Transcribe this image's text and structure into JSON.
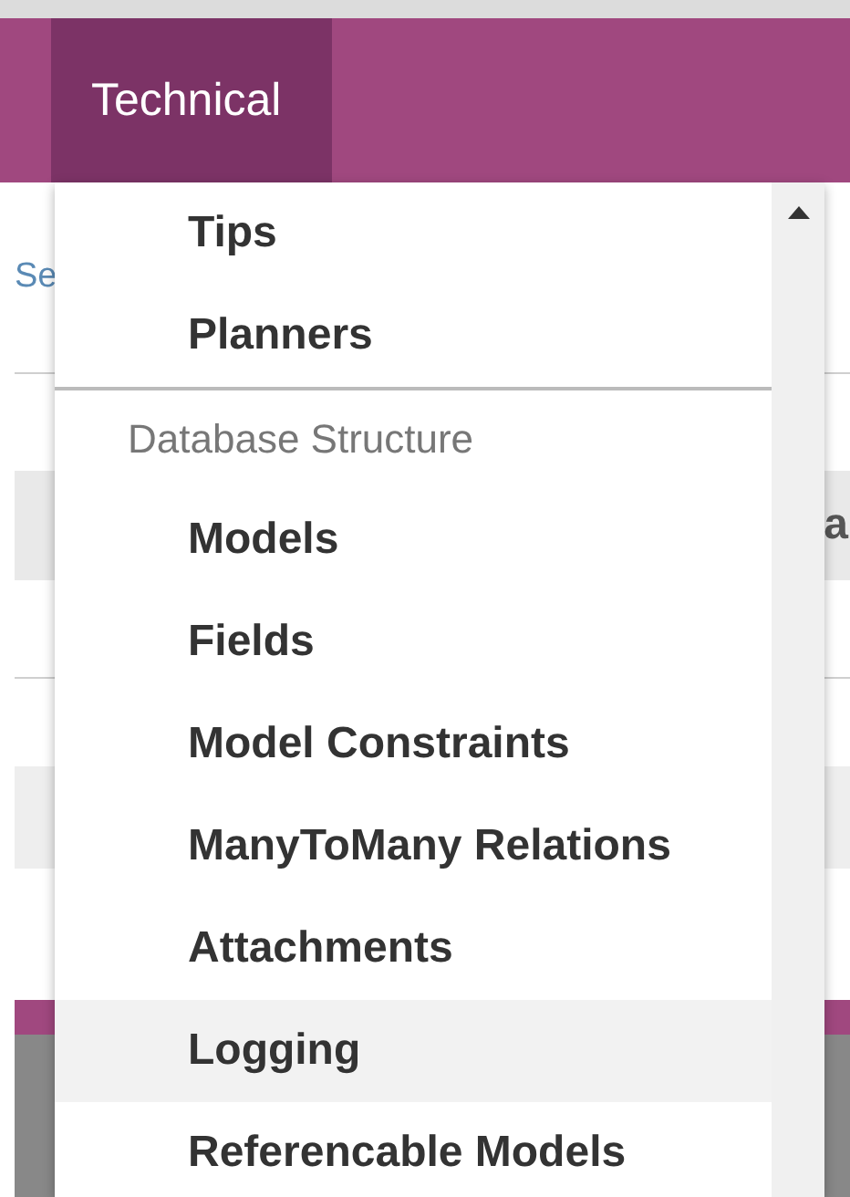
{
  "navbar": {
    "items": [
      {
        "label": "Technical",
        "selected": true
      }
    ]
  },
  "background": {
    "left_text": "Se",
    "right_text": "a"
  },
  "dropdown": {
    "entries": [
      {
        "kind": "item",
        "label": "Tips",
        "highlighted": false
      },
      {
        "kind": "item",
        "label": "Planners",
        "highlighted": false
      },
      {
        "kind": "divider"
      },
      {
        "kind": "header",
        "label": "Database Structure"
      },
      {
        "kind": "item",
        "label": "Models",
        "highlighted": false
      },
      {
        "kind": "item",
        "label": "Fields",
        "highlighted": false
      },
      {
        "kind": "item",
        "label": "Model Constraints",
        "highlighted": false
      },
      {
        "kind": "item",
        "label": "ManyToMany Relations",
        "highlighted": false
      },
      {
        "kind": "item",
        "label": "Attachments",
        "highlighted": false
      },
      {
        "kind": "item",
        "label": "Logging",
        "highlighted": true
      },
      {
        "kind": "item",
        "label": "Referencable Models",
        "highlighted": false
      }
    ]
  }
}
